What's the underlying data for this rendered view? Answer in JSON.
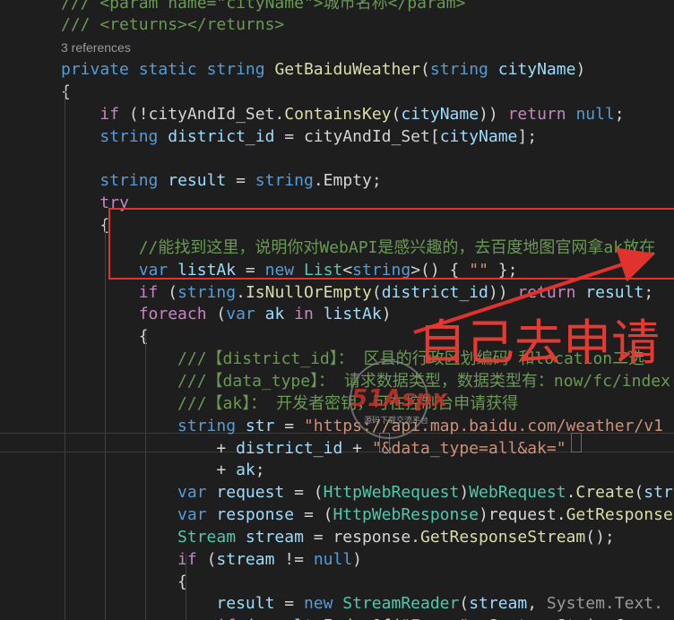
{
  "colors": {
    "background": "#1e1e1e",
    "keyword": "#569cd6",
    "control": "#c586c0",
    "type": "#4ec9b0",
    "method": "#dcdcaa",
    "variable": "#9cdcfe",
    "string": "#ce9178",
    "comment": "#6a9955",
    "plain": "#d4d4d4",
    "codelens": "#999999",
    "annotation": "#e0332d"
  },
  "annotation": {
    "label": "自己去申请"
  },
  "watermark": {
    "label": "51Aspx",
    "sub": "源码下载交流平台"
  },
  "editor": {
    "lines": [
      [
        {
          "t": "/// <param name=\"cityName\">城市名称</param>",
          "c": "comment"
        }
      ],
      [
        {
          "t": "/// <returns></returns>",
          "c": "comment"
        }
      ],
      [
        {
          "t": "3 references",
          "c": "codelens"
        }
      ],
      [
        {
          "t": "private",
          "c": "keyword"
        },
        {
          "t": " ",
          "c": "plain"
        },
        {
          "t": "static",
          "c": "keyword"
        },
        {
          "t": " ",
          "c": "plain"
        },
        {
          "t": "string",
          "c": "keyword"
        },
        {
          "t": " ",
          "c": "plain"
        },
        {
          "t": "GetBaiduWeather",
          "c": "method"
        },
        {
          "t": "(",
          "c": "plain"
        },
        {
          "t": "string",
          "c": "keyword"
        },
        {
          "t": " ",
          "c": "plain"
        },
        {
          "t": "cityName",
          "c": "variable"
        },
        {
          "t": ")",
          "c": "plain"
        }
      ],
      [
        {
          "t": "{",
          "c": "plain"
        }
      ],
      [
        {
          "t": "    ",
          "c": "plain"
        },
        {
          "t": "if",
          "c": "control"
        },
        {
          "t": " (!cityAndId_Set.",
          "c": "plain"
        },
        {
          "t": "ContainsKey",
          "c": "method"
        },
        {
          "t": "(",
          "c": "plain"
        },
        {
          "t": "cityName",
          "c": "variable"
        },
        {
          "t": ")) ",
          "c": "plain"
        },
        {
          "t": "return",
          "c": "control"
        },
        {
          "t": " ",
          "c": "plain"
        },
        {
          "t": "null",
          "c": "keyword"
        },
        {
          "t": ";",
          "c": "plain"
        }
      ],
      [
        {
          "t": "    ",
          "c": "plain"
        },
        {
          "t": "string",
          "c": "keyword"
        },
        {
          "t": " ",
          "c": "plain"
        },
        {
          "t": "district_id",
          "c": "variable"
        },
        {
          "t": " = cityAndId_Set[",
          "c": "plain"
        },
        {
          "t": "cityName",
          "c": "variable"
        },
        {
          "t": "];",
          "c": "plain"
        }
      ],
      [],
      [
        {
          "t": "    ",
          "c": "plain"
        },
        {
          "t": "string",
          "c": "keyword"
        },
        {
          "t": " ",
          "c": "plain"
        },
        {
          "t": "result",
          "c": "variable"
        },
        {
          "t": " = ",
          "c": "plain"
        },
        {
          "t": "string",
          "c": "keyword"
        },
        {
          "t": ".Empty;",
          "c": "plain"
        }
      ],
      [
        {
          "t": "    ",
          "c": "plain"
        },
        {
          "t": "try",
          "c": "control"
        }
      ],
      [
        {
          "t": "    {",
          "c": "plain"
        }
      ],
      [
        {
          "t": "        ",
          "c": "plain"
        },
        {
          "t": "//能找到这里，说明你对WebAPI是感兴趣的，去百度地图官网拿ak放在",
          "c": "comment"
        }
      ],
      [
        {
          "t": "        ",
          "c": "plain"
        },
        {
          "t": "var",
          "c": "keyword"
        },
        {
          "t": " ",
          "c": "plain"
        },
        {
          "t": "listAk",
          "c": "variable"
        },
        {
          "t": " = ",
          "c": "plain"
        },
        {
          "t": "new",
          "c": "keyword"
        },
        {
          "t": " ",
          "c": "plain"
        },
        {
          "t": "List",
          "c": "type"
        },
        {
          "t": "<",
          "c": "plain"
        },
        {
          "t": "string",
          "c": "keyword"
        },
        {
          "t": ">() { ",
          "c": "plain"
        },
        {
          "t": "\"\"",
          "c": "string"
        },
        {
          "t": " };",
          "c": "plain"
        }
      ],
      [
        {
          "t": "        ",
          "c": "plain"
        },
        {
          "t": "if",
          "c": "control"
        },
        {
          "t": " (",
          "c": "plain"
        },
        {
          "t": "string",
          "c": "keyword"
        },
        {
          "t": ".",
          "c": "plain"
        },
        {
          "t": "IsNullOrEmpty",
          "c": "method"
        },
        {
          "t": "(",
          "c": "plain"
        },
        {
          "t": "district_id",
          "c": "variable"
        },
        {
          "t": ")) ",
          "c": "plain"
        },
        {
          "t": "return",
          "c": "control"
        },
        {
          "t": " ",
          "c": "plain"
        },
        {
          "t": "result",
          "c": "variable"
        },
        {
          "t": ";",
          "c": "plain"
        }
      ],
      [
        {
          "t": "        ",
          "c": "plain"
        },
        {
          "t": "foreach",
          "c": "control"
        },
        {
          "t": " (",
          "c": "plain"
        },
        {
          "t": "var",
          "c": "keyword"
        },
        {
          "t": " ",
          "c": "plain"
        },
        {
          "t": "ak",
          "c": "variable"
        },
        {
          "t": " ",
          "c": "plain"
        },
        {
          "t": "in",
          "c": "control"
        },
        {
          "t": " ",
          "c": "plain"
        },
        {
          "t": "listAk",
          "c": "variable"
        },
        {
          "t": ")",
          "c": "plain"
        }
      ],
      [
        {
          "t": "        {",
          "c": "plain"
        }
      ],
      [
        {
          "t": "            ",
          "c": "plain"
        },
        {
          "t": "///【district_id】： 区县的行政区划编码 和location二选",
          "c": "comment"
        }
      ],
      [
        {
          "t": "            ",
          "c": "plain"
        },
        {
          "t": "///【data_type】： 请求数据类型，数据类型有：now/fc/index",
          "c": "comment"
        }
      ],
      [
        {
          "t": "            ",
          "c": "plain"
        },
        {
          "t": "///【ak】： 开发者密钥，可在控制台申请获得",
          "c": "comment"
        }
      ],
      [
        {
          "t": "            ",
          "c": "plain"
        },
        {
          "t": "string",
          "c": "keyword"
        },
        {
          "t": " ",
          "c": "plain"
        },
        {
          "t": "str",
          "c": "variable"
        },
        {
          "t": " = ",
          "c": "plain"
        },
        {
          "t": "\"https://api.map.baidu.com/weather/v1",
          "c": "string"
        }
      ],
      [
        {
          "t": "                + ",
          "c": "plain"
        },
        {
          "t": "district_id",
          "c": "variable"
        },
        {
          "t": " + ",
          "c": "plain"
        },
        {
          "t": "\"&data_type=all&ak=\"",
          "c": "string"
        }
      ],
      [
        {
          "t": "                + ",
          "c": "plain"
        },
        {
          "t": "ak",
          "c": "variable"
        },
        {
          "t": ";",
          "c": "plain"
        }
      ],
      [
        {
          "t": "            ",
          "c": "plain"
        },
        {
          "t": "var",
          "c": "keyword"
        },
        {
          "t": " ",
          "c": "plain"
        },
        {
          "t": "request",
          "c": "variable"
        },
        {
          "t": " = (",
          "c": "plain"
        },
        {
          "t": "HttpWebRequest",
          "c": "type"
        },
        {
          "t": ")",
          "c": "plain"
        },
        {
          "t": "WebRequest",
          "c": "type"
        },
        {
          "t": ".",
          "c": "plain"
        },
        {
          "t": "Create",
          "c": "method"
        },
        {
          "t": "(",
          "c": "plain"
        },
        {
          "t": "str",
          "c": "variable"
        },
        {
          "t": ");",
          "c": "plain"
        }
      ],
      [
        {
          "t": "            ",
          "c": "plain"
        },
        {
          "t": "var",
          "c": "keyword"
        },
        {
          "t": " ",
          "c": "plain"
        },
        {
          "t": "response",
          "c": "variable"
        },
        {
          "t": " = (",
          "c": "plain"
        },
        {
          "t": "HttpWebResponse",
          "c": "type"
        },
        {
          "t": ")request.",
          "c": "plain"
        },
        {
          "t": "GetResponse",
          "c": "method"
        },
        {
          "t": "();",
          "c": "plain"
        }
      ],
      [
        {
          "t": "            ",
          "c": "plain"
        },
        {
          "t": "Stream",
          "c": "type"
        },
        {
          "t": " ",
          "c": "plain"
        },
        {
          "t": "stream",
          "c": "variable"
        },
        {
          "t": " = response.",
          "c": "plain"
        },
        {
          "t": "GetResponseStream",
          "c": "method"
        },
        {
          "t": "();",
          "c": "plain"
        }
      ],
      [
        {
          "t": "            ",
          "c": "plain"
        },
        {
          "t": "if",
          "c": "control"
        },
        {
          "t": " (",
          "c": "plain"
        },
        {
          "t": "stream",
          "c": "variable"
        },
        {
          "t": " != ",
          "c": "plain"
        },
        {
          "t": "null",
          "c": "keyword"
        },
        {
          "t": ")",
          "c": "plain"
        }
      ],
      [
        {
          "t": "            {",
          "c": "plain"
        }
      ],
      [
        {
          "t": "                ",
          "c": "plain"
        },
        {
          "t": "result",
          "c": "variable"
        },
        {
          "t": " = ",
          "c": "plain"
        },
        {
          "t": "new",
          "c": "keyword"
        },
        {
          "t": " ",
          "c": "plain"
        },
        {
          "t": "StreamReader",
          "c": "type"
        },
        {
          "t": "(",
          "c": "plain"
        },
        {
          "t": "stream",
          "c": "variable"
        },
        {
          "t": ", ",
          "c": "plain"
        },
        {
          "t": "System.Text.",
          "c": "codelens"
        }
      ],
      [
        {
          "t": "                ",
          "c": "plain"
        },
        {
          "t": "if",
          "c": "control"
        },
        {
          "t": " (",
          "c": "plain"
        },
        {
          "t": "result",
          "c": "variable"
        },
        {
          "t": ".",
          "c": "plain"
        },
        {
          "t": "IndexOf",
          "c": "method"
        },
        {
          "t": "(",
          "c": "plain"
        },
        {
          "t": "\"Error\"",
          "c": "string"
        },
        {
          "t": ", System.StringComp",
          "c": "plain"
        }
      ]
    ]
  }
}
